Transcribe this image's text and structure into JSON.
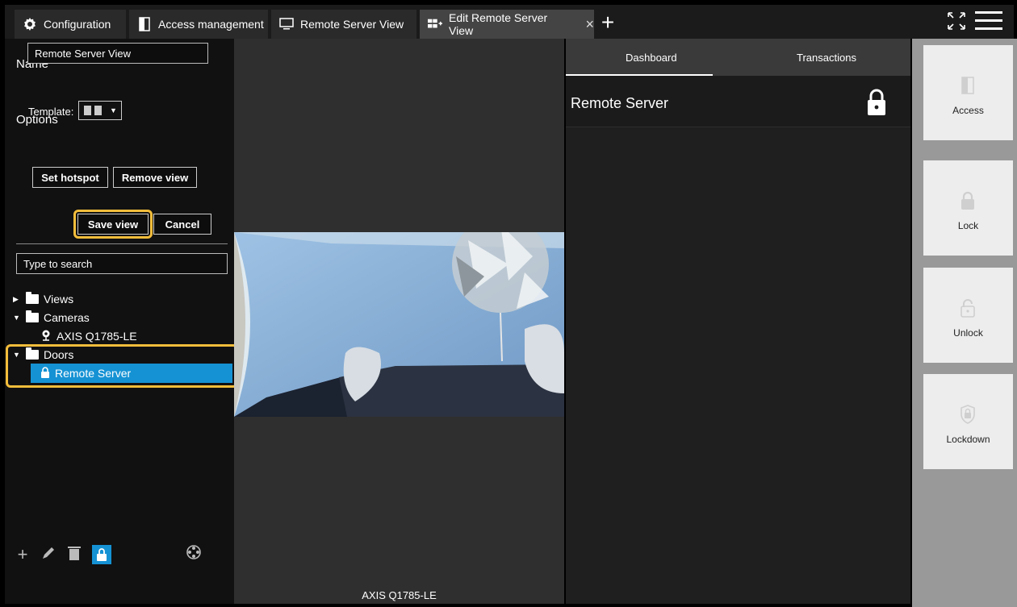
{
  "tabs": [
    {
      "label": "Configuration",
      "icon": "gear-icon",
      "active": false
    },
    {
      "label": "Access management",
      "icon": "door-icon",
      "active": false
    },
    {
      "label": "Remote Server View",
      "icon": "monitor-icon",
      "active": false
    },
    {
      "label": "Edit Remote Server View",
      "icon": "edit-view-icon",
      "active": true
    }
  ],
  "tab_add_label": "+",
  "tab_close_label": "×",
  "left_panel": {
    "name_label": "Name",
    "name_value": "Remote Server View",
    "options_label": "Options",
    "template_label": "Template:",
    "set_hotspot_label": "Set hotspot",
    "remove_view_label": "Remove view",
    "save_view_label": "Save view",
    "cancel_label": "Cancel",
    "search_placeholder": "Type to search",
    "tree": {
      "views_label": "Views",
      "cameras_label": "Cameras",
      "camera_item": "AXIS Q1785-LE",
      "doors_label": "Doors",
      "door_item": "Remote Server"
    }
  },
  "center": {
    "camera_label": "AXIS Q1785-LE"
  },
  "dashboard": {
    "tab_dashboard": "Dashboard",
    "tab_transactions": "Transactions",
    "title": "Remote Server"
  },
  "actions": [
    {
      "label": "Access",
      "icon": "door-icon"
    },
    {
      "label": "Lock",
      "icon": "lock-icon"
    },
    {
      "label": "Unlock",
      "icon": "unlock-icon"
    },
    {
      "label": "Lockdown",
      "icon": "shield-lock-icon"
    }
  ],
  "colors": {
    "accent": "#1592d4",
    "highlight": "#f3bd3b",
    "panel_bg": "#111111",
    "action_bg": "#ededed"
  }
}
